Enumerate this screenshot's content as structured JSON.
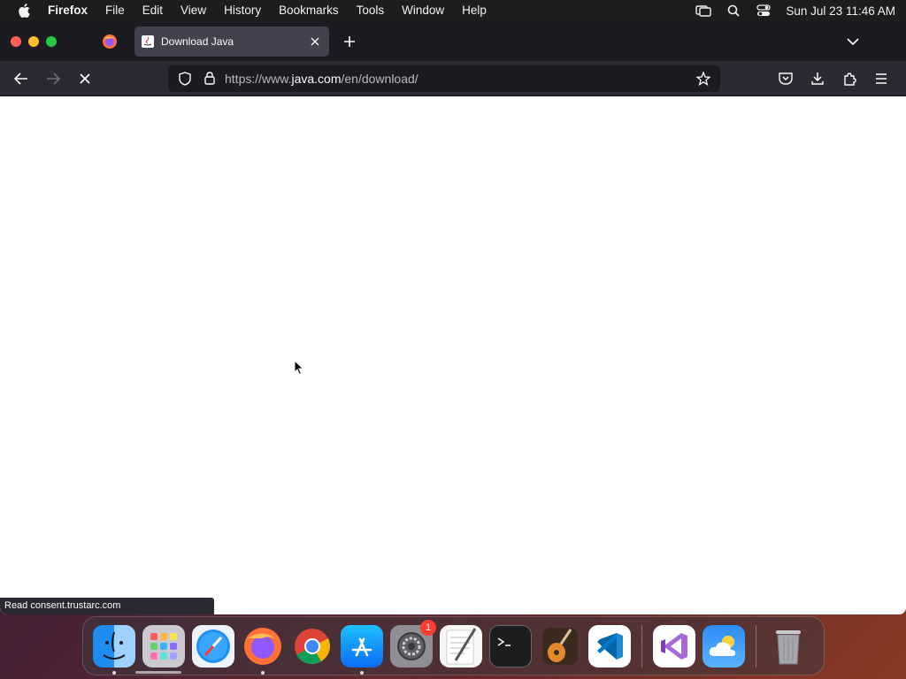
{
  "menubar": {
    "app_name": "Firefox",
    "items": [
      "File",
      "Edit",
      "View",
      "History",
      "Bookmarks",
      "Tools",
      "Window",
      "Help"
    ],
    "clock": "Sun Jul 23  11:46 AM"
  },
  "browser": {
    "tab_title": "Download Java",
    "url_prefix": "https://www.",
    "url_domain": "java.com",
    "url_path": "/en/download/",
    "status_text": "Read consent.trustarc.com"
  },
  "dock": {
    "settings_badge": "1"
  },
  "colors": {
    "menubar_bg": "#1d1d1f",
    "tabbar_bg": "#1c1b22",
    "navbar_bg": "#2b2a33",
    "active_tab_bg": "#42414d",
    "content_bg": "#ffffff"
  }
}
